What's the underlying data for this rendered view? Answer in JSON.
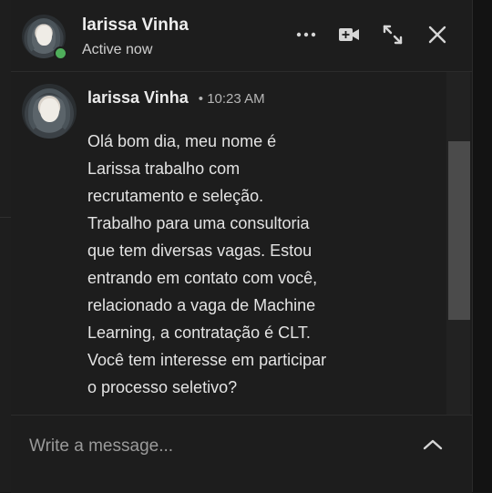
{
  "header": {
    "name": "larissa Vinha",
    "status": "Active now",
    "icons": [
      "more-icon",
      "video-call-icon",
      "maximize-icon",
      "close-icon"
    ]
  },
  "message": {
    "sender": "larissa Vinha",
    "separator": "•",
    "time": "10:23 AM",
    "body": "Olá bom dia, meu nome é\nLarissa trabalho com\nrecrutamento e seleção.\nTrabalho para uma consultoria\nque tem diversas vagas. Estou\nentrando em contato com você,\nrelacionado a vaga de Machine\nLearning, a contratação é CLT.\nVocê tem interesse em participar\no processo seletivo?"
  },
  "composer": {
    "placeholder": "Write a message...",
    "value": "",
    "expand_icon": "chevron-up-icon"
  },
  "colors": {
    "background": "#1d1d1d",
    "online": "#4fae5b",
    "text": "#e3e3e3"
  }
}
